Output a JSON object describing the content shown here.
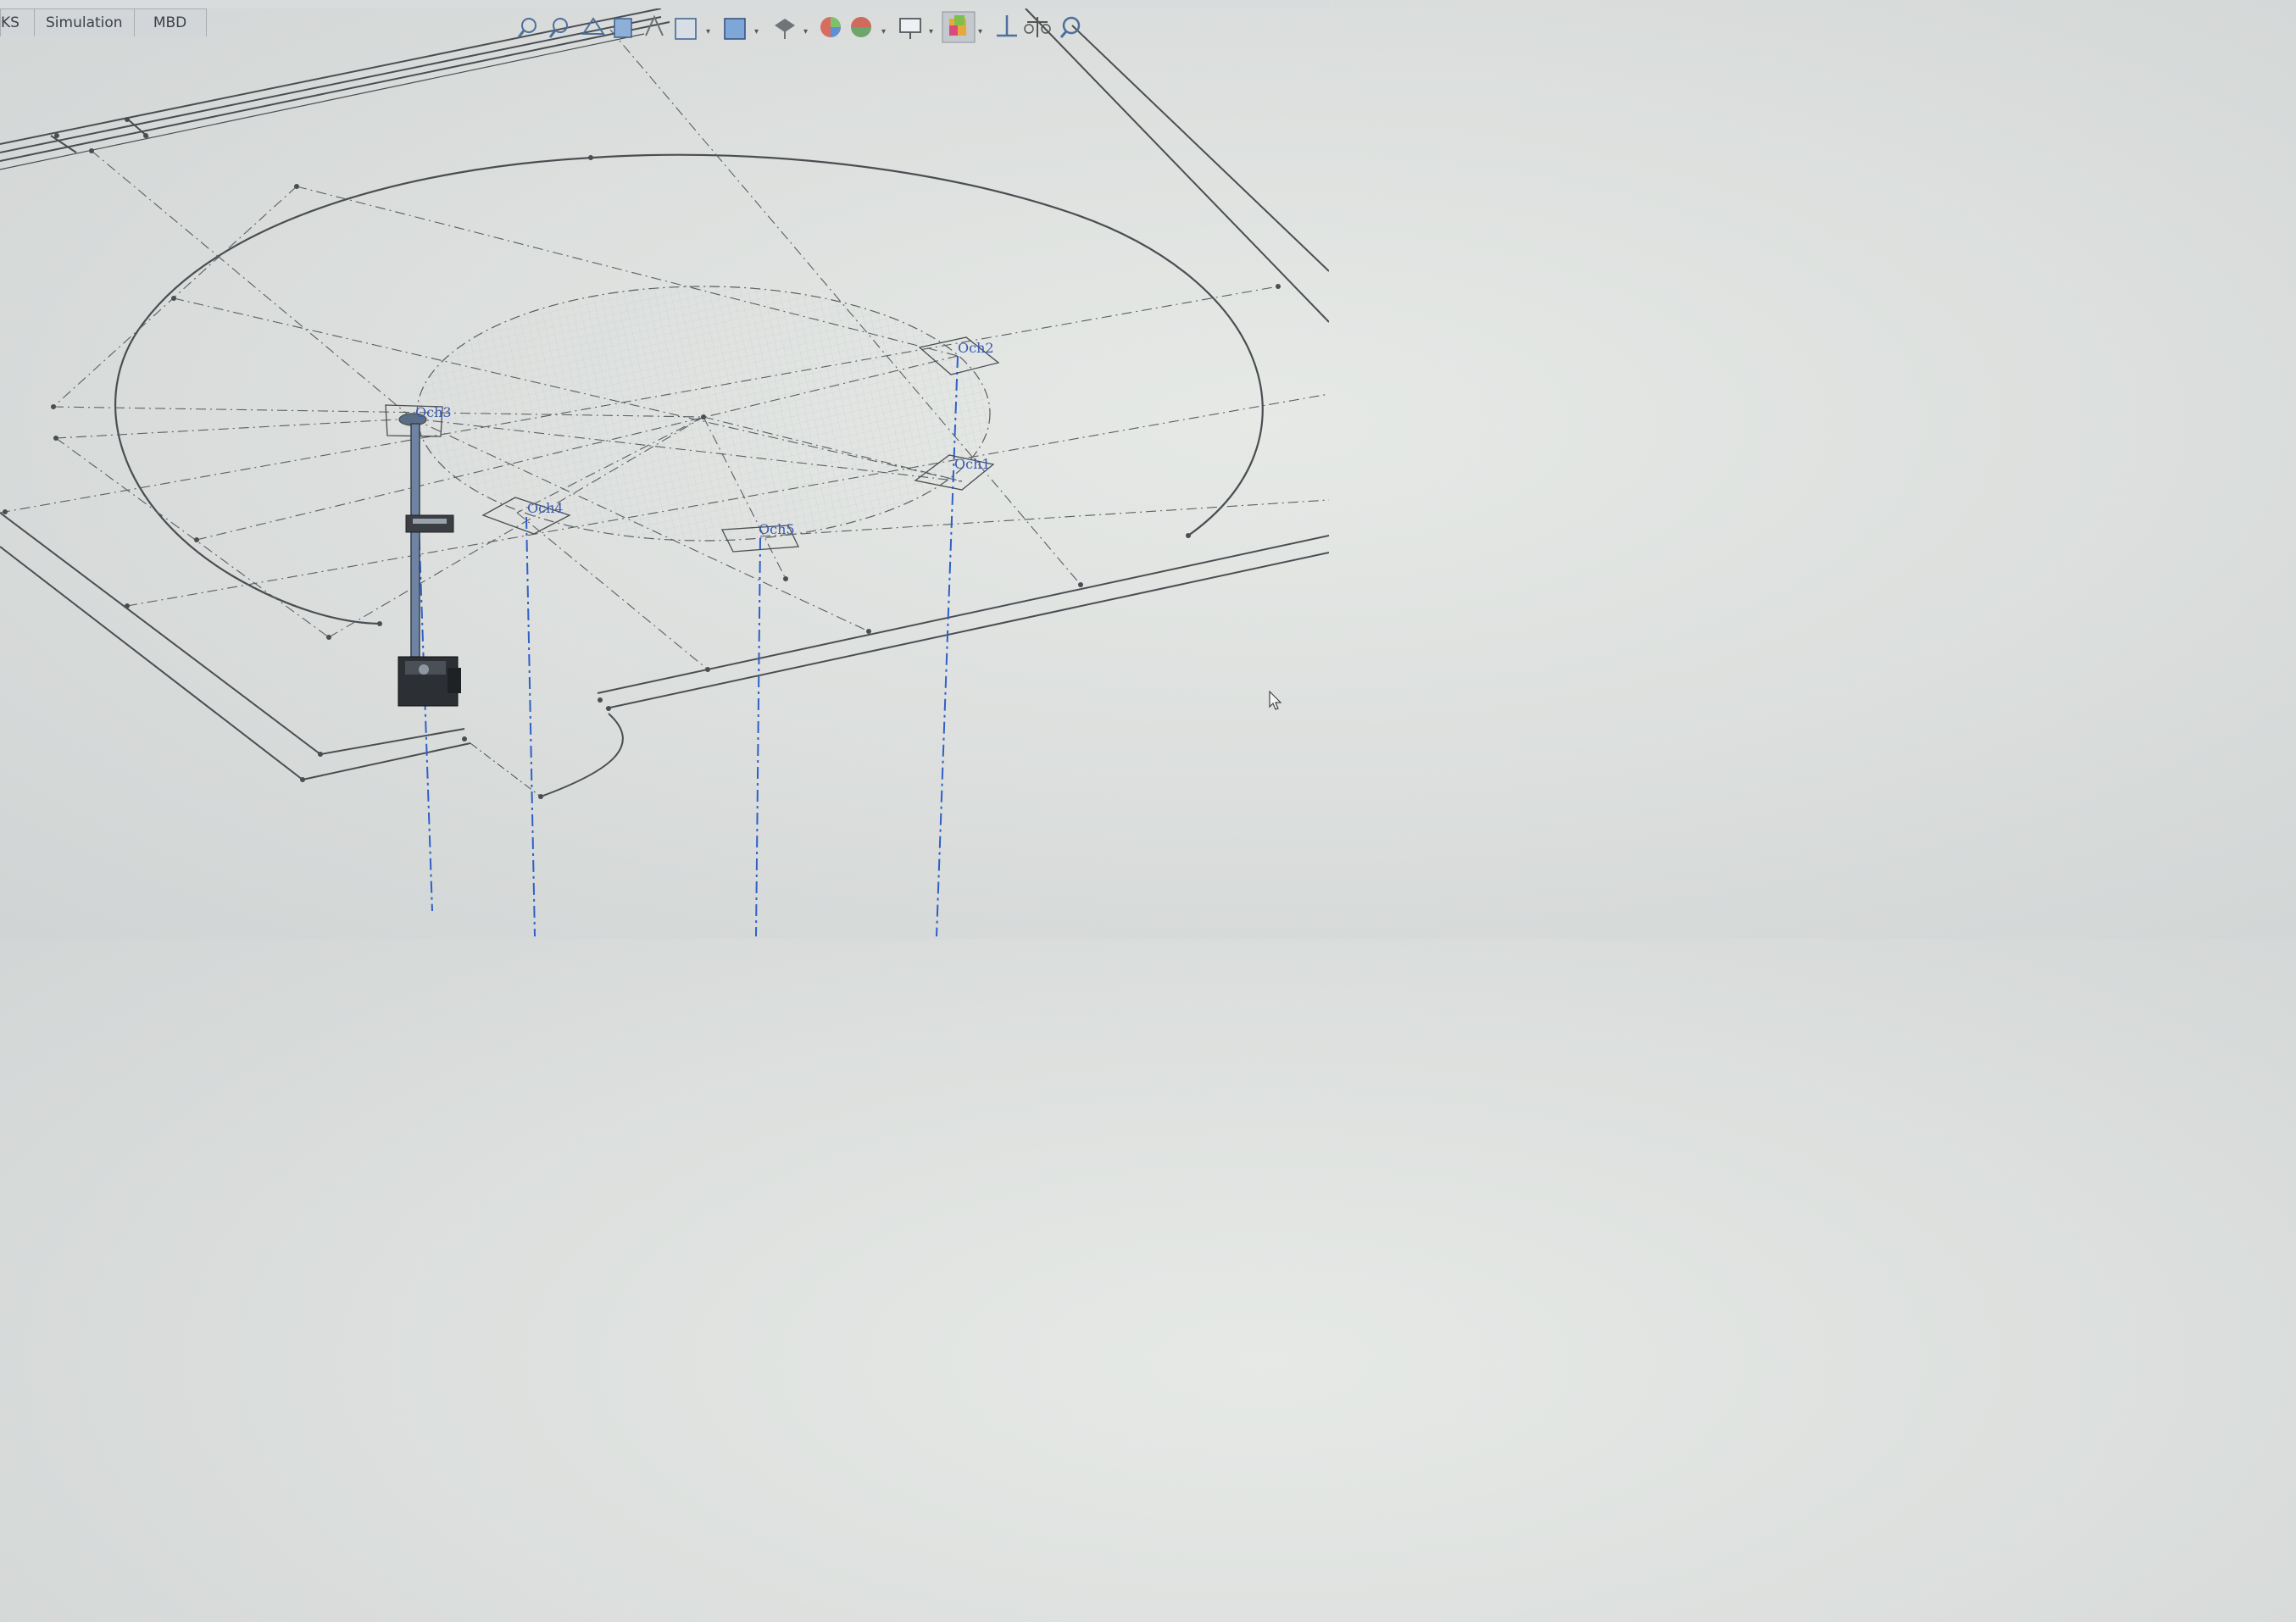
{
  "tabs": [
    {
      "label": "KS"
    },
    {
      "label": "Simulation"
    },
    {
      "label": "MBD"
    }
  ],
  "toolbar": {
    "icons": [
      "zoom-to-fit-icon",
      "zoom-to-area-icon",
      "previous-view-icon",
      "section-view-icon",
      "dynamic-annotation-icon",
      "view-orientation-icon",
      "display-style-icon",
      "hide-show-items-icon",
      "edit-appearance-icon",
      "apply-scene-icon",
      "view-settings-icon",
      "render-tools-icon",
      "reference-geometry-icon",
      "mass-properties-icon",
      "design-check-icon"
    ]
  },
  "sketch_points": [
    {
      "label": "Осh3"
    },
    {
      "label": "Осh2"
    },
    {
      "label": "Осh1"
    },
    {
      "label": "Осh4"
    },
    {
      "label": "Осh5"
    }
  ],
  "colors": {
    "sketch_line": "#4a4e52",
    "construction_line": "#5a5f63",
    "axis_line": "#2f5fc8",
    "label_text": "#3a5ab0",
    "mesh": "#c5cbc9"
  }
}
